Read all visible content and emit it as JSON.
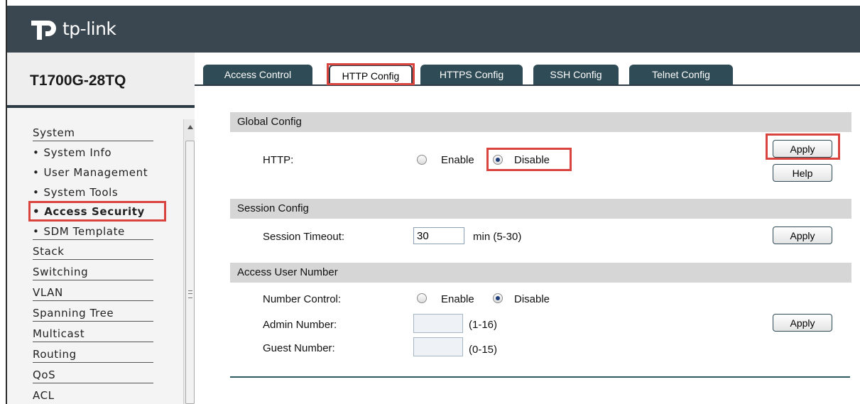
{
  "header": {
    "logo_text": "tp-link",
    "logo_icon": "tp-link-logo-icon"
  },
  "device": {
    "model": "T1700G-28TQ"
  },
  "sidebar": {
    "items": [
      {
        "label": "System",
        "type": "section"
      },
      {
        "label": "System Info",
        "type": "sub"
      },
      {
        "label": "User Management",
        "type": "sub"
      },
      {
        "label": "System Tools",
        "type": "sub"
      },
      {
        "label": "Access Security",
        "type": "sub",
        "active": true
      },
      {
        "label": "SDM Template",
        "type": "sub"
      },
      {
        "label": "Stack",
        "type": "section"
      },
      {
        "label": "Switching",
        "type": "section"
      },
      {
        "label": "VLAN",
        "type": "section"
      },
      {
        "label": "Spanning Tree",
        "type": "section"
      },
      {
        "label": "Multicast",
        "type": "section"
      },
      {
        "label": "Routing",
        "type": "section"
      },
      {
        "label": "QoS",
        "type": "section"
      },
      {
        "label": "ACL",
        "type": "section"
      }
    ]
  },
  "tabs": [
    {
      "label": "Access Control"
    },
    {
      "label": "HTTP Config",
      "active": true
    },
    {
      "label": "HTTPS Config"
    },
    {
      "label": "SSH Config"
    },
    {
      "label": "Telnet Config"
    }
  ],
  "global_config": {
    "title": "Global Config",
    "http_label": "HTTP:",
    "enable_label": "Enable",
    "disable_label": "Disable",
    "selected": "Disable",
    "apply_label": "Apply",
    "help_label": "Help"
  },
  "session_config": {
    "title": "Session Config",
    "timeout_label": "Session Timeout:",
    "timeout_value": "30",
    "range_label": "min (5-30)",
    "apply_label": "Apply"
  },
  "access_user": {
    "title": "Access User Number",
    "number_control_label": "Number Control:",
    "enable_label": "Enable",
    "disable_label": "Disable",
    "selected": "Disable",
    "admin_label": "Admin Number:",
    "admin_value": "",
    "admin_range": "(1-16)",
    "guest_label": "Guest Number:",
    "guest_value": "",
    "guest_range": "(0-15)",
    "apply_label": "Apply"
  },
  "colors": {
    "header_bg": "#3a4750",
    "tab_bg": "#2f4b55",
    "highlight": "#d9453e",
    "section_bg": "#d6d6d6"
  }
}
